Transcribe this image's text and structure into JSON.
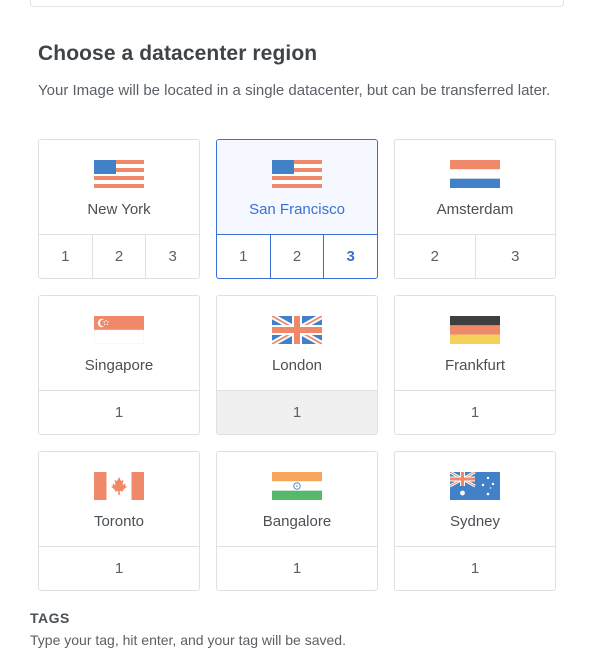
{
  "section": {
    "title": "Choose a datacenter region",
    "description": "Your Image will be located in a single datacenter, but can be transferred later."
  },
  "regions": [
    {
      "city": "New York",
      "flag": "us-flag-icon",
      "numbers": [
        "1",
        "2",
        "3"
      ],
      "selected": false
    },
    {
      "city": "San Francisco",
      "flag": "us-flag-icon",
      "numbers": [
        "1",
        "2",
        "3"
      ],
      "selected": true,
      "active_number": "3"
    },
    {
      "city": "Amsterdam",
      "flag": "netherlands-flag-icon",
      "numbers": [
        "2",
        "3"
      ],
      "selected": false
    },
    {
      "city": "Singapore",
      "flag": "singapore-flag-icon",
      "numbers": [
        "1"
      ],
      "selected": false
    },
    {
      "city": "London",
      "flag": "uk-flag-icon",
      "numbers": [
        "1"
      ],
      "selected": false,
      "disabled": true
    },
    {
      "city": "Frankfurt",
      "flag": "germany-flag-icon",
      "numbers": [
        "1"
      ],
      "selected": false
    },
    {
      "city": "Toronto",
      "flag": "canada-flag-icon",
      "numbers": [
        "1"
      ],
      "selected": false
    },
    {
      "city": "Bangalore",
      "flag": "india-flag-icon",
      "numbers": [
        "1"
      ],
      "selected": false
    },
    {
      "city": "Sydney",
      "flag": "australia-flag-icon",
      "numbers": [
        "1"
      ],
      "selected": false
    }
  ],
  "tags": {
    "label": "TAGS",
    "help": "Type your tag, hit enter, and your tag will be saved."
  },
  "colors": {
    "accent": "#3b6fd6",
    "flag_red": "#f0896a",
    "flag_blue": "#4281c8",
    "flag_green": "#56b86a",
    "flag_yellow": "#f5d15c",
    "flag_dark": "#3f3f3f"
  }
}
